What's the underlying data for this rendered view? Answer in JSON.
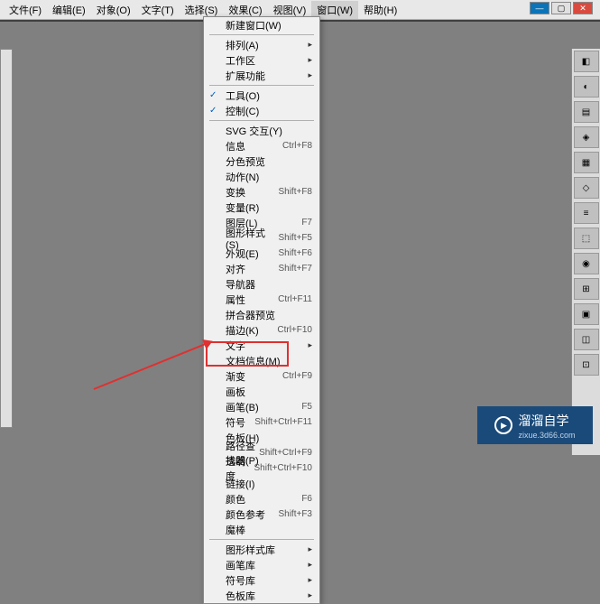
{
  "menubar": {
    "items": [
      "文件(F)",
      "编辑(E)",
      "对象(O)",
      "文字(T)",
      "选择(S)",
      "效果(C)",
      "视图(V)",
      "窗口(W)",
      "帮助(H)"
    ]
  },
  "dropdown": {
    "groups": [
      [
        {
          "label": "新建窗口(W)",
          "shortcut": ""
        }
      ],
      [
        {
          "label": "排列(A)",
          "shortcut": "",
          "sub": true
        },
        {
          "label": "工作区",
          "shortcut": "",
          "sub": true
        },
        {
          "label": "扩展功能",
          "shortcut": "",
          "sub": true
        }
      ],
      [
        {
          "label": "工具(O)",
          "shortcut": "",
          "checked": true
        },
        {
          "label": "控制(C)",
          "shortcut": "",
          "checked": true
        }
      ],
      [
        {
          "label": "SVG 交互(Y)",
          "shortcut": ""
        },
        {
          "label": "信息",
          "shortcut": "Ctrl+F8"
        },
        {
          "label": "分色预览",
          "shortcut": ""
        },
        {
          "label": "动作(N)",
          "shortcut": ""
        },
        {
          "label": "变换",
          "shortcut": "Shift+F8"
        },
        {
          "label": "变量(R)",
          "shortcut": ""
        },
        {
          "label": "图层(L)",
          "shortcut": "F7"
        },
        {
          "label": "图形样式(S)",
          "shortcut": "Shift+F5"
        },
        {
          "label": "外观(E)",
          "shortcut": "Shift+F6"
        },
        {
          "label": "对齐",
          "shortcut": "Shift+F7"
        },
        {
          "label": "导航器",
          "shortcut": ""
        },
        {
          "label": "属性",
          "shortcut": "Ctrl+F11"
        },
        {
          "label": "拼合器预览",
          "shortcut": ""
        },
        {
          "label": "描边(K)",
          "shortcut": "Ctrl+F10"
        },
        {
          "label": "文字",
          "shortcut": "",
          "sub": true
        },
        {
          "label": "文档信息(M)",
          "shortcut": ""
        },
        {
          "label": "渐变",
          "shortcut": "Ctrl+F9"
        },
        {
          "label": "画板",
          "shortcut": ""
        },
        {
          "label": "画笔(B)",
          "shortcut": "F5"
        },
        {
          "label": "符号",
          "shortcut": "Shift+Ctrl+F11"
        },
        {
          "label": "色板(H)",
          "shortcut": ""
        },
        {
          "label": "路径查找器(P)",
          "shortcut": "Shift+Ctrl+F9"
        },
        {
          "label": "透明度",
          "shortcut": "Shift+Ctrl+F10"
        },
        {
          "label": "链接(I)",
          "shortcut": ""
        },
        {
          "label": "颜色",
          "shortcut": "F6"
        },
        {
          "label": "颜色参考",
          "shortcut": "Shift+F3"
        },
        {
          "label": "魔棒",
          "shortcut": ""
        }
      ],
      [
        {
          "label": "图形样式库",
          "shortcut": "",
          "sub": true
        },
        {
          "label": "画笔库",
          "shortcut": "",
          "sub": true
        },
        {
          "label": "符号库",
          "shortcut": "",
          "sub": true
        },
        {
          "label": "色板库",
          "shortcut": "",
          "sub": true
        }
      ]
    ]
  },
  "right_panel_icons": [
    "◧",
    "◐",
    "▤",
    "◈",
    "▦",
    "◇",
    "≡",
    "⬚",
    "◉",
    "⊞",
    "▣",
    "◫",
    "⊡"
  ],
  "watermark": {
    "brand": "溜溜自学",
    "url": "zixue.3d66.com"
  }
}
